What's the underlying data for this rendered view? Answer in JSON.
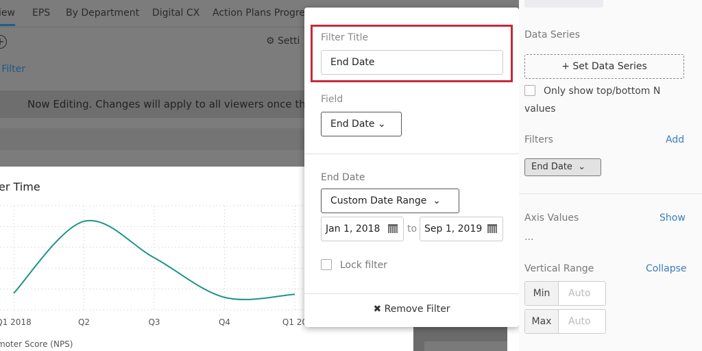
{
  "tabs": [
    "iew",
    "EPS",
    "By Department",
    "Digital CX",
    "Action Plans Progres"
  ],
  "toolbar": {
    "settings_label": "Setti",
    "add_filter_label": "l Filter"
  },
  "banner": "Now Editing. Changes will apply to all viewers once this",
  "chart_data": {
    "type": "line",
    "title": "er Time",
    "categories": [
      "Q1 2018",
      "Q2",
      "Q3",
      "Q4",
      "Q1 20"
    ],
    "series": [
      {
        "name": "Net Promoter Score (NPS)",
        "values": [
          16,
          85,
          50,
          12,
          15
        ],
        "color": "#1b9482"
      }
    ],
    "xlabel": "moter Score (NPS)",
    "ylabel": "",
    "ylim": [
      0,
      100
    ],
    "grid": true
  },
  "popup": {
    "filter_title_label": "Filter Title",
    "filter_title_value": "End Date",
    "field_label": "Field",
    "field_value": "End Date",
    "end_date_label": "End Date",
    "range_value": "Custom Date Range",
    "from_date": "Jan 1, 2018",
    "to_label": "to",
    "to_date": "Sep 1, 2019",
    "lock_label": "Lock filter",
    "remove_label": "Remove Filter"
  },
  "panel": {
    "data_series_label": "Data Series",
    "set_data_series": "Set Data Series",
    "top_bottom_label": "Only show top/bottom N",
    "top_bottom_label2": "values",
    "filters_label": "Filters",
    "add_label": "Add",
    "filter_chip": "End Date",
    "axis_values_label": "Axis Values",
    "show_label": "Show",
    "axis_values_value": "...",
    "vertical_range_label": "Vertical Range",
    "collapse_label": "Collapse",
    "min_label": "Min",
    "max_label": "Max",
    "min_placeholder": "Auto",
    "max_placeholder": "Auto"
  },
  "colors": {
    "accent": "#3a7cc0",
    "highlight": "#c8283a",
    "line": "#1b9482"
  }
}
